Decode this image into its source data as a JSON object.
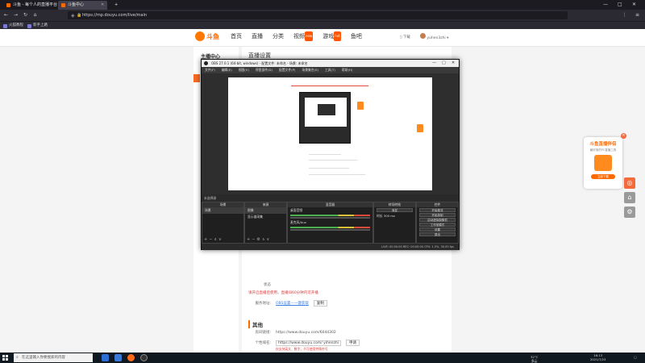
{
  "browser": {
    "tabs": [
      {
        "title": "斗鱼 - 每个人的直播平台",
        "active": false
      },
      {
        "title": "斗鱼中心",
        "active": true
      }
    ],
    "url": "https://mp.douyu.com/live/main",
    "bookmarks": [
      {
        "label": "火狐教程"
      },
      {
        "label": "新手上路"
      }
    ],
    "window_controls": [
      "—",
      "□",
      "✕"
    ]
  },
  "site": {
    "logo_text": "斗鱼",
    "nav": [
      {
        "label": "首页"
      },
      {
        "label": "直播"
      },
      {
        "label": "分类"
      },
      {
        "label": "视频",
        "badge": "new"
      },
      {
        "label": "游戏",
        "badge": "hot"
      },
      {
        "label": "鱼吧"
      }
    ],
    "download_label": "下载",
    "username": "yuhen3zhi"
  },
  "sidebar": {
    "title": "主播中心"
  },
  "content": {
    "title": "直播设置",
    "notice_red": "请开启直播后使用，直播间60分钟内可开播",
    "address_label": "服务地址:",
    "address_value": "OBS设置—一键获取",
    "copy_label": "复制",
    "section_other": "其他",
    "room_link_label": "房间链接:",
    "room_link_value": "https://www.douyu.com/6044302",
    "nickname_label": "个性域名:",
    "nickname_value": "https://www.douyu.com/ yihenzhi",
    "apply_label": "申请",
    "nickname_hint": "仅支持英文、数字，不可使用特殊符号",
    "level_label": "直播等级:",
    "level_value": "12",
    "level_link1": "查看等级规则",
    "level_link2": "查看积分规则",
    "status_label": "状态"
  },
  "float_ad": {
    "title": "斗鱼直播伴侣",
    "subtitle": "最好用的PC直播工具",
    "button": "立即下载",
    "close": "✕"
  },
  "obs": {
    "title": "OBS 27.0.1 (64-bit, windows) - 配置文件: 未命名 - 场景: 未命名",
    "menu": [
      "文件(F)",
      "编辑(E)",
      "视图(V)",
      "停靠部件(D)",
      "配置文件(P)",
      "场景集合(S)",
      "工具(T)",
      "帮助(H)"
    ],
    "mid_bar": "未选择源",
    "docks": {
      "scenes": {
        "header": "场景",
        "items": [
          "场景"
        ]
      },
      "sources": {
        "header": "来源",
        "items": [
          "图像",
          "显示器采集"
        ]
      },
      "mixer": {
        "header": "混音器",
        "channels": [
          {
            "name": "桌面音频",
            "db": "0.0 dB"
          },
          {
            "name": "麦克风/Aux",
            "db": "0.0 dB"
          }
        ]
      },
      "transitions": {
        "header": "转场特效",
        "type": "渐变",
        "duration_label": "时长",
        "duration": "300 ms"
      },
      "controls": {
        "header": "控件",
        "buttons": [
          "开始推流",
          "开始录制",
          "启动虚拟摄像机",
          "工作室模式",
          "设置",
          "退出"
        ]
      }
    },
    "status": "LIVE: 00:00:00  REC: 00:00:00  CPU: 1.3%, 30.00 fps"
  },
  "taskbar": {
    "search_placeholder": "在这里输入你要搜索的内容",
    "tray_time": "16:13",
    "tray_date": "2021/7/23",
    "weather": "32°C",
    "weather_desc": "多云"
  }
}
